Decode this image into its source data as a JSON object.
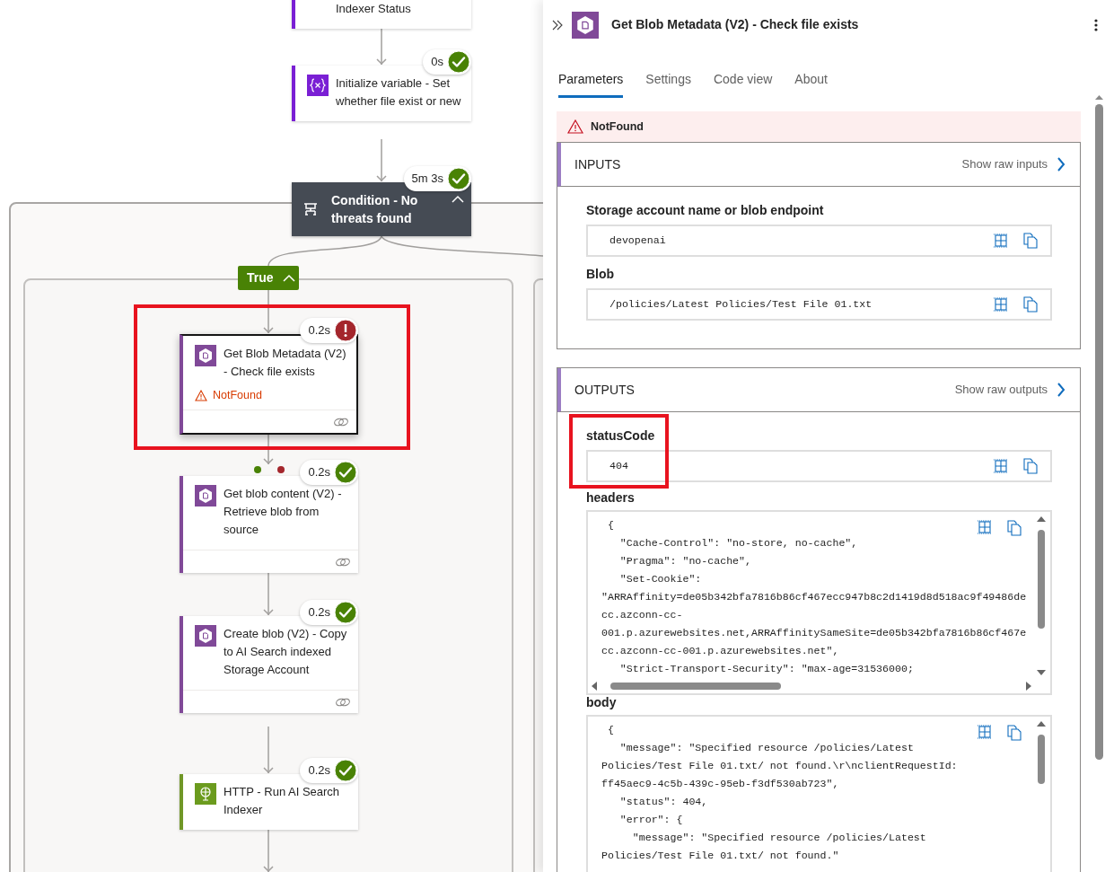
{
  "flow": {
    "nodes": [
      {
        "kind": "control",
        "title": "Indexer Status",
        "selected": false
      },
      {
        "kind": "variable",
        "title": "Initialize variable - Set whether file exist or new",
        "failed": false,
        "duration": "0s",
        "selected": false
      },
      {
        "kind": "condition",
        "title": "Condition - No threats found",
        "failed": false,
        "duration": "5m 3s",
        "expanded": true
      },
      {
        "kind": "storage",
        "title": "Get Blob Metadata (V2) - Check file exists",
        "failed": true,
        "duration": "0.2s",
        "error": "NotFound",
        "connection": true,
        "selected": true
      },
      {
        "kind": "storage",
        "title": "Get blob content (V2) - Retrieve blob from source",
        "failed": false,
        "duration": "0.2s",
        "connection": true,
        "selected": false,
        "run_after": [
          {
            "color": "#498205"
          },
          {
            "color": "#a4262c"
          }
        ]
      },
      {
        "kind": "storage",
        "title": "Create blob (V2) - Copy to AI Search indexed Storage Account",
        "failed": false,
        "duration": "0.2s",
        "connection": true,
        "selected": false
      },
      {
        "kind": "http",
        "title": "HTTP - Run AI Search Indexer",
        "failed": false,
        "duration": "0.2s",
        "selected": false
      }
    ],
    "branch": {
      "label": "True",
      "expanded": true
    }
  },
  "panel": {
    "kind": "storage",
    "title": "Get Blob Metadata (V2) - Check file exists",
    "tabs": [
      {
        "label": "Parameters",
        "selected": true
      },
      {
        "label": "Settings",
        "selected": false
      },
      {
        "label": "Code view",
        "selected": false
      },
      {
        "label": "About",
        "selected": false
      }
    ],
    "error": "NotFound",
    "sections": [
      {
        "title": "INPUTS",
        "raw_link": "Show raw inputs",
        "params": [
          {
            "kind": "value",
            "label": "Storage account name or blob endpoint",
            "value": "devopenai"
          },
          {
            "kind": "value",
            "label": "Blob",
            "value": "/policies/Latest Policies/Test File 01.txt"
          }
        ]
      },
      {
        "title": "OUTPUTS",
        "raw_link": "Show raw outputs",
        "params": [
          {
            "kind": "value",
            "label": "statusCode",
            "value": "404"
          },
          {
            "kind": "code",
            "label": "headers",
            "lines": [
              " {",
              "   \"Cache-Control\": \"no-store, no-cache\",",
              "   \"Pragma\": \"no-cache\",",
              "   \"Set-Cookie\":",
              "\"ARRAffinity=de05b342bfa7816b86cf467ecc947b8c2d1419d8d518ac9f49486de",
              "cc.azconn-cc-",
              "001.p.azurewebsites.net,ARRAffinitySameSite=de05b342bfa7816b86cf467e",
              "cc.azconn-cc-001.p.azurewebsites.net\",",
              "   \"Strict-Transport-Security\": \"max-age=31536000;"
            ]
          },
          {
            "kind": "code",
            "label": "body",
            "lines": [
              " {",
              "   \"message\": \"Specified resource /policies/Latest",
              "Policies/Test File 01.txt/ not found.\\r\\nclientRequestId:",
              "ff45aec9-4c5b-439c-95eb-f3df530ab723\",",
              "   \"status\": 404,",
              "   \"error\": {",
              "     \"message\": \"Specified resource /policies/Latest",
              "Policies/Test File 01.txt/ not found.\""
            ]
          }
        ]
      }
    ]
  }
}
